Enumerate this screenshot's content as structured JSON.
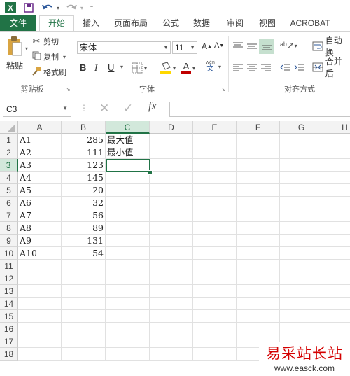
{
  "qat": {
    "icons": [
      "excel-app-icon",
      "save-icon",
      "undo-icon",
      "redo-icon",
      "customize-icon"
    ]
  },
  "tabs": {
    "file": "文件",
    "home": "开始",
    "insert": "插入",
    "page_layout": "页面布局",
    "formulas": "公式",
    "data": "数据",
    "review": "审阅",
    "view": "视图",
    "acrobat": "ACROBAT"
  },
  "ribbon": {
    "clipboard": {
      "paste": "粘贴",
      "cut": "剪切",
      "copy": "复制",
      "format_painter": "格式刷",
      "label": "剪贴板"
    },
    "font": {
      "font_name": "宋体",
      "font_size": "11",
      "bold": "B",
      "italic": "I",
      "underline": "U",
      "wen": "文",
      "label": "字体"
    },
    "alignment": {
      "wrap_text": "自动换",
      "merge": "合并后",
      "label": "对齐方式"
    },
    "accent_color": "#217346",
    "font_color": "#c00000",
    "fill_color": "#ffd800"
  },
  "formula_bar": {
    "name_box": "C3",
    "fx": "fx",
    "formula": ""
  },
  "sheet": {
    "columns": [
      "A",
      "B",
      "C",
      "D",
      "E",
      "F",
      "G",
      "H"
    ],
    "rows": [
      "1",
      "2",
      "3",
      "4",
      "5",
      "6",
      "7",
      "8",
      "9",
      "10",
      "11",
      "12",
      "13",
      "14",
      "15",
      "16",
      "17",
      "18"
    ],
    "col_a": [
      "A1",
      "A2",
      "A3",
      "A4",
      "A5",
      "A6",
      "A7",
      "A8",
      "A9",
      "A10"
    ],
    "col_b": [
      "285",
      "111",
      "123",
      "145",
      "20",
      "32",
      "56",
      "89",
      "131",
      "54"
    ],
    "col_c": [
      "最大值",
      "最小值"
    ],
    "selected_cell": "C3"
  },
  "watermark": {
    "title": "易采站长站",
    "url": "www.easck.com"
  }
}
